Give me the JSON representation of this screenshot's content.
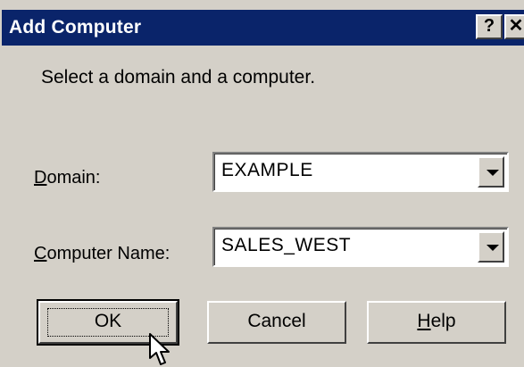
{
  "window": {
    "title": "Add Computer",
    "help_glyph": "?",
    "close_glyph": "✕"
  },
  "instruction": "Select a domain and a computer.",
  "domain": {
    "label_mnemonic": "D",
    "label_rest": "omain:",
    "value": "EXAMPLE"
  },
  "computer": {
    "label_mnemonic": "C",
    "label_rest": "omputer Name:",
    "value": "SALES_WEST"
  },
  "buttons": {
    "ok": "OK",
    "cancel": "Cancel",
    "help_mnemonic": "H",
    "help_rest": "elp"
  },
  "colors": {
    "titlebar": "#0a246a",
    "face": "#d4d0c8"
  }
}
